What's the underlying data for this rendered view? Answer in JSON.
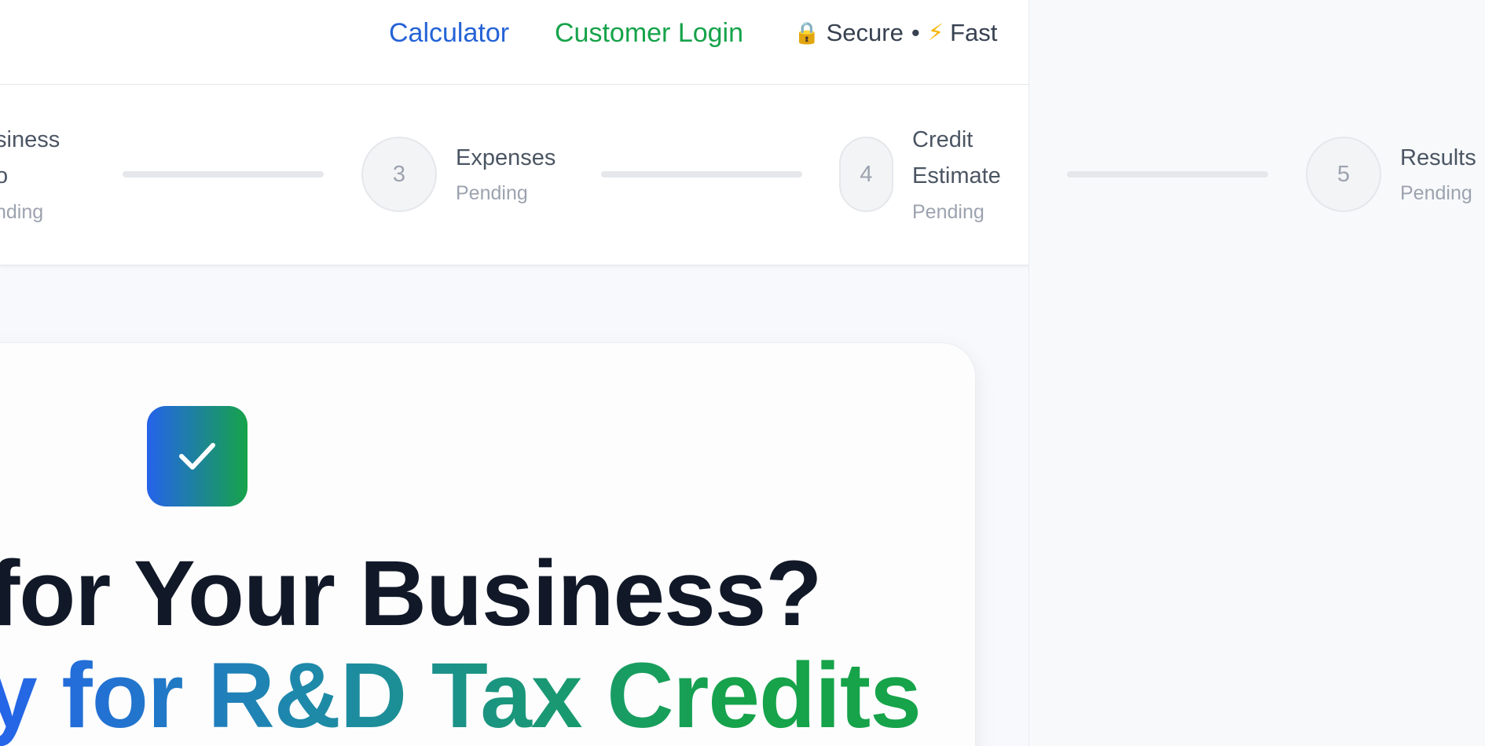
{
  "header": {
    "nav": {
      "calculator": "Calculator",
      "customer_login": "Customer Login"
    },
    "trust": {
      "secure": "Secure",
      "separator": "•",
      "fast": "Fast"
    }
  },
  "stepper": {
    "steps": [
      {
        "title_line1": "siness",
        "title_line2": "o",
        "status": "nding"
      },
      {
        "number": "3",
        "title": "Expenses",
        "status": "Pending"
      },
      {
        "number": "4",
        "title_line1": "Credit",
        "title_line2": "Estimate",
        "status": "Pending"
      },
      {
        "number": "5",
        "title": "Results",
        "status": "Pending"
      }
    ]
  },
  "hero": {
    "headline_line1": "for Your Business?",
    "headline_line2": "y for R&D Tax Credits"
  },
  "colors": {
    "primary_blue": "#2563eb",
    "primary_green": "#16a34a",
    "text_dark": "#111827",
    "muted": "#9ca3af"
  },
  "icons": {
    "lock": "lock-icon",
    "bolt": "lightning-icon",
    "check": "checkmark-icon"
  }
}
